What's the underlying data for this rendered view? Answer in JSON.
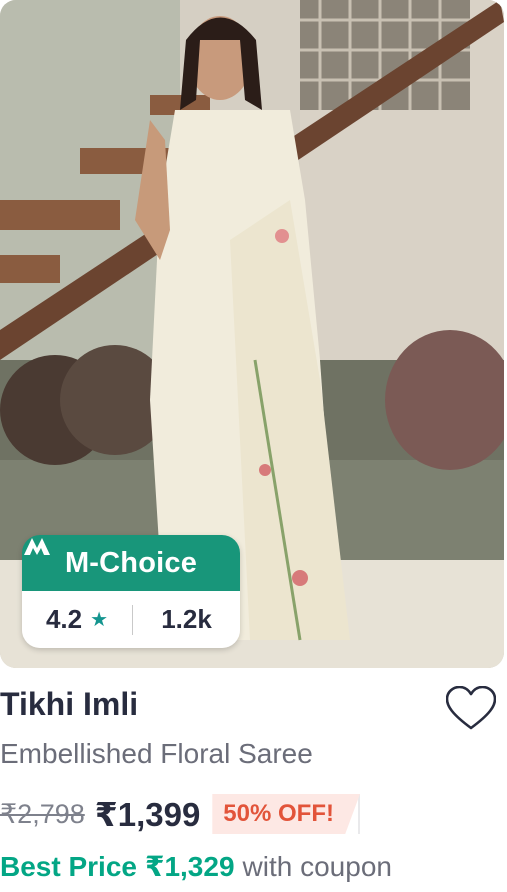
{
  "product": {
    "badge": {
      "label": "M-Choice",
      "rating": "4.2",
      "rating_count": "1.2k"
    },
    "brand": "Tikhi Imli",
    "description": "Embellished Floral Saree",
    "mrp": "₹2,798",
    "price": "₹1,399",
    "discount": "50% OFF!",
    "best_price_label": "Best Price",
    "best_price_value": "₹1,329",
    "best_price_suffix": "with coupon"
  },
  "icons": {
    "wishlist": "heart-outline-icon",
    "rating": "star-icon",
    "badge_logo": "myntra-m-icon"
  },
  "colors": {
    "badge_green": "#18967a",
    "best_price_green": "#03a685",
    "discount_red": "#e2543a",
    "text_dark": "#282c3f",
    "text_muted": "#6b6d79"
  }
}
